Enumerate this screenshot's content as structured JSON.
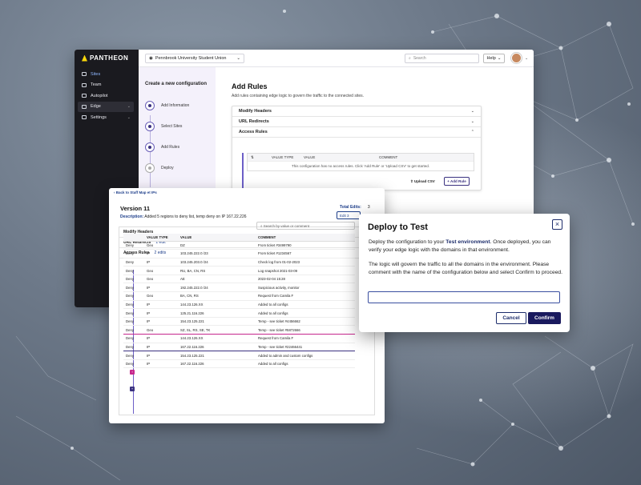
{
  "app": {
    "brand": "PANTHEON",
    "site_selector": "Pennbrook University Student Union",
    "search_placeholder": "Search",
    "help_label": "Help",
    "nav": [
      {
        "label": "Sites"
      },
      {
        "label": "Team"
      },
      {
        "label": "Autopilot"
      },
      {
        "label": "Edge"
      },
      {
        "label": "Settings"
      }
    ]
  },
  "wizard": {
    "title": "Create a new configuration",
    "steps": [
      "Add Information",
      "Select Sites",
      "Add Rules",
      "Deploy"
    ]
  },
  "rules": {
    "heading": "Add Rules",
    "subtitle": "Add rules containing edge logic to govern the traffic to the connected sites.",
    "sections": [
      "Modify Headers",
      "URL Redirects",
      "Access Rules"
    ],
    "columns": [
      "VALUE TYPE",
      "VALUE",
      "COMMENT"
    ],
    "empty_message": "This configuration has no access rules. Click 'Add Rule' or 'Upload CSV' to get started.",
    "upload_label": "Upload CSV",
    "add_rule_label": "+ Add Rule"
  },
  "version": {
    "back_link": "Back to Staff Map et IPs",
    "title": "Version 11",
    "description_label": "Description:",
    "description": "Added 5 regions to deny list, temp deny on IP 167.22.226",
    "total_edits_label": "Total Edits:",
    "total_edits": "3",
    "edit_label": "Edit 3",
    "sections": [
      {
        "label": "Modify Headers",
        "edits": ""
      },
      {
        "label": "URL Redirects",
        "edits": "1 edit"
      },
      {
        "label": "Access Rules",
        "edits": "2 edits"
      }
    ],
    "search_placeholder": "Search by value or comment",
    "columns": [
      "",
      "VALUE TYPE",
      "VALUE",
      "COMMENT"
    ],
    "rows": [
      [
        "Deny",
        "Geo",
        "DZ",
        "From ticket #3499790"
      ],
      [
        "Deny",
        "IP",
        "103.245.222.0 /23",
        "From ticket #1234567"
      ],
      [
        "Deny",
        "IP",
        "103.245.203.0 /24",
        "Check log from 01-02-2023"
      ],
      [
        "Deny",
        "Geo",
        "RU, BA, CN, RS",
        "Log snapshot 2021-03-09"
      ],
      [
        "Deny",
        "Geo",
        "AE",
        "2023-02-04 15:28"
      ],
      [
        "Deny",
        "IP",
        "192.245.222.0 /24",
        "Suspicious activity, monitor"
      ],
      [
        "Deny",
        "Geo",
        "BA, CN, RS",
        "Request from Camila F"
      ],
      [
        "Deny",
        "IP",
        "144.23.126.XX",
        "Added to all configs"
      ],
      [
        "Deny",
        "IP",
        "125.21.116.226",
        "Added to all configs"
      ],
      [
        "Deny",
        "IP",
        "154.23.125.221",
        "Temp - see ticket #4456662"
      ],
      [
        "Deny",
        "Geo",
        "SZ, SL, RS, SE, TK",
        "Temp - see ticket #5872666"
      ],
      [
        "Deny",
        "IP",
        "144.23.126.XX",
        "Request from Camila F"
      ],
      [
        "Deny",
        "IP",
        "167.22.116.226",
        "Temp - see ticket #22466441"
      ],
      [
        "Deny",
        "IP",
        "154.23.125.221",
        "Added to admin and custom configs"
      ],
      [
        "Deny",
        "IP",
        "167.22.116.226",
        "Added to all configs"
      ]
    ]
  },
  "modal": {
    "title": "Deploy to Test",
    "p1_before": "Deploy the configuration to your ",
    "p1_link": "Test environment",
    "p1_after": ". Once deployed, you can verify your edge logic with the domains in that environment.",
    "p2": "The logic will govern the traffic to all the domains in the environment. Please comment with the name of the configuration below and select Confirm to proceed.",
    "input_value": "",
    "cancel_label": "Cancel",
    "confirm_label": "Confirm"
  },
  "colors": {
    "accent": "#3a3180",
    "link": "#1d3e8a",
    "sidebar": "#1a1a1f",
    "modified": "#c6278d"
  }
}
